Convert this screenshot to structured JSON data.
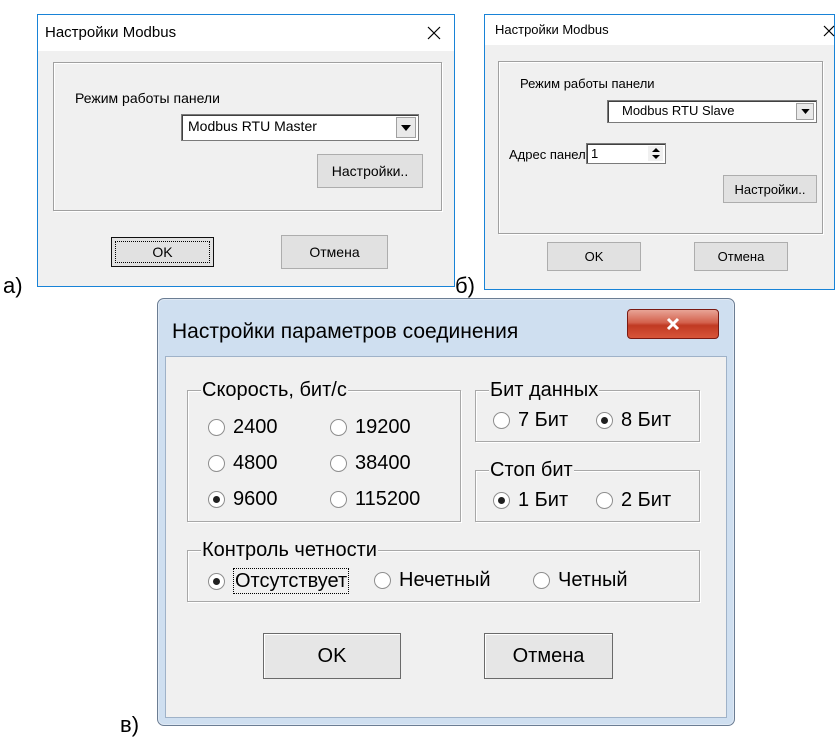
{
  "labels": {
    "a": "а)",
    "b": "б)",
    "c": "в)"
  },
  "dialog_a": {
    "title": "Настройки Modbus",
    "mode_label": "Режим работы панели",
    "mode_value": "Modbus RTU Master",
    "settings_button": "Настройки..",
    "ok_button": "OK",
    "cancel_button": "Отмена"
  },
  "dialog_b": {
    "title": "Настройки Modbus",
    "mode_label": "Режим работы панели",
    "mode_value": "Modbus RTU Slave",
    "address_label": "Адрес панели",
    "address_value": "1",
    "settings_button": "Настройки..",
    "ok_button": "OK",
    "cancel_button": "Отмена"
  },
  "dialog_c": {
    "title": "Настройки параметров соединения",
    "speed_group": "Скорость, бит/с",
    "speed_options": [
      "2400",
      "19200",
      "4800",
      "38400",
      "9600",
      "115200"
    ],
    "speed_selected": "9600",
    "databits_group": "Бит данных",
    "databits_options": [
      "7 Бит",
      "8 Бит"
    ],
    "databits_selected": "8 Бит",
    "stopbits_group": "Стоп бит",
    "stopbits_options": [
      "1 Бит",
      "2 Бит"
    ],
    "stopbits_selected": "1 Бит",
    "parity_group": "Контроль четности",
    "parity_options": [
      "Отсутствует",
      "Нечетный",
      "Четный"
    ],
    "parity_selected": "Отсутствует",
    "ok_button": "OK",
    "cancel_button": "Отмена"
  },
  "colors": {
    "win10_border": "#1883d7",
    "win7_frame": "#cfdff0",
    "close_button_red": "#c03a22"
  }
}
